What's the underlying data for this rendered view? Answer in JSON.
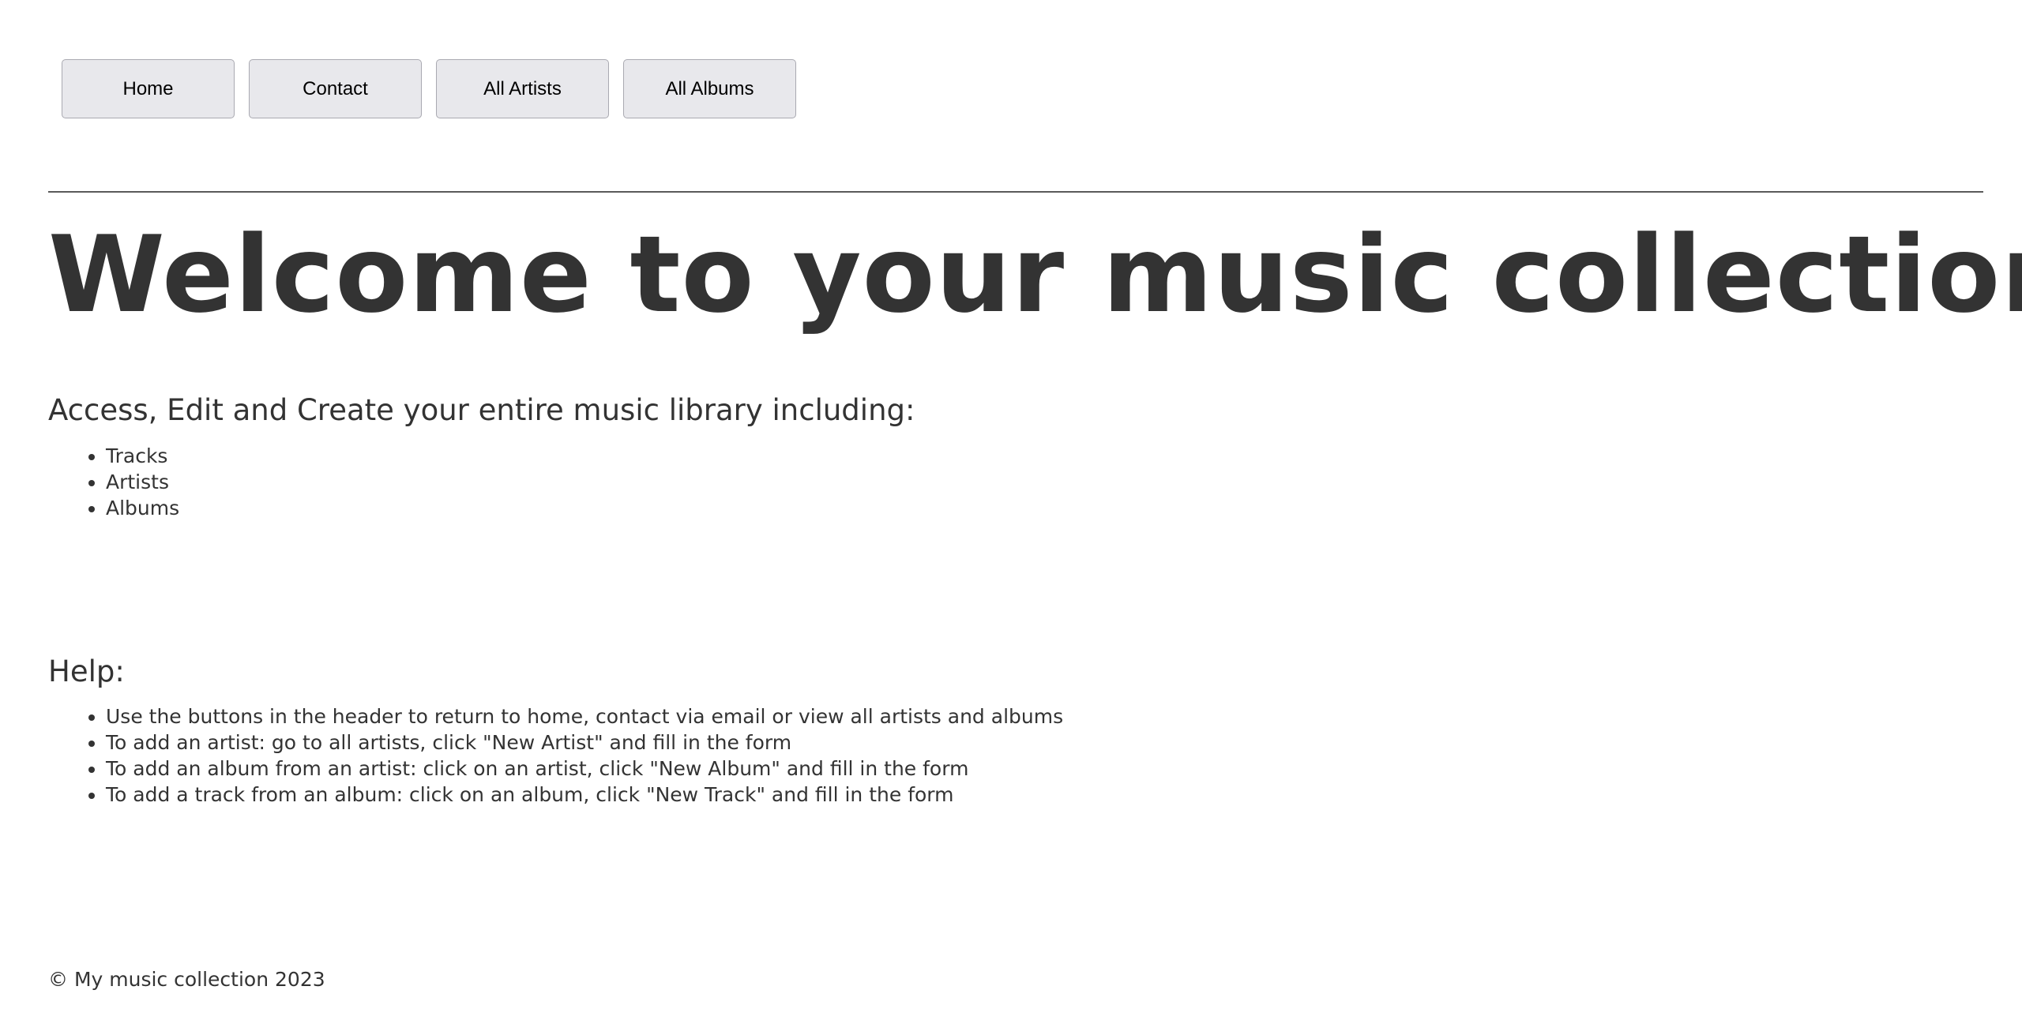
{
  "nav": {
    "buttons": [
      {
        "label": "Home"
      },
      {
        "label": "Contact"
      },
      {
        "label": "All Artists"
      },
      {
        "label": "All Albums"
      }
    ]
  },
  "main": {
    "title": "Welcome to your music collection",
    "intro": "Access, Edit and Create your entire music library including:",
    "features": [
      "Tracks",
      "Artists",
      "Albums"
    ],
    "help_title": "Help:",
    "help_items": [
      "Use the buttons in the header to return to home, contact via email or view all artists and albums",
      "To add an artist: go to all artists, click \"New Artist\" and fill in the form",
      "To add an album from an artist: click on an artist, click \"New Album\" and fill in the form",
      "To add a track from an album: click on an album, click \"New Track\" and fill in the form"
    ]
  },
  "footer": {
    "text": "© My music collection 2023"
  },
  "colors": {
    "text": "#333333",
    "button_bg": "#e8e8ec",
    "button_border": "#a9a9b1",
    "rule": "#5a5a5a"
  }
}
